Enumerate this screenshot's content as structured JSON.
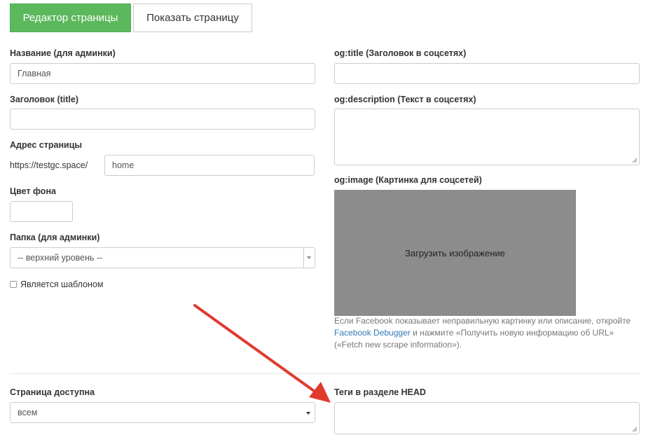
{
  "tabs": {
    "editor_label": "Редактор страницы",
    "show_label": "Показать страницу"
  },
  "left": {
    "name_label": "Название (для админки)",
    "name_value": "Главная",
    "title_label": "Заголовок (title)",
    "title_value": "",
    "address_label": "Адрес страницы",
    "address_prefix": "https://testgc.space/",
    "address_value": "home",
    "bg_color_label": "Цвет фона",
    "bg_color_value": "",
    "folder_label": "Папка (для админки)",
    "folder_value": "-- верхний уровень --",
    "template_checkbox_label": "Является шаблоном",
    "template_checked": false,
    "access_label": "Страница доступна",
    "access_value": "всем"
  },
  "right": {
    "og_title_label": "og:title (Заголовок в соцсетях)",
    "og_title_value": "",
    "og_description_label": "og:description (Текст в соцсетях)",
    "og_image_label": "og:image (Картинка для соцсетей)",
    "upload_label": "Загрузить изображение",
    "help_text_1": "Если Facebook показывает неправильную картинку или описание, откройте",
    "help_link": "Facebook Debugger",
    "help_text_2": " и нажмите «Получить новую информацию об URL»",
    "help_text_3": "(«Fetch new scrape information»).",
    "head_tags_label": "Теги в разделе HEAD"
  },
  "colors": {
    "primary_button": "#5cb85c",
    "link": "#337ab7",
    "annotation_arrow": "#e03a2f",
    "image_placeholder": "#8c8c8c"
  },
  "icons": {
    "folder_dropdown": "chevron-down-icon",
    "access_dropdown": "caret-down-icon",
    "annotation": "red-arrow-annotation-icon"
  }
}
